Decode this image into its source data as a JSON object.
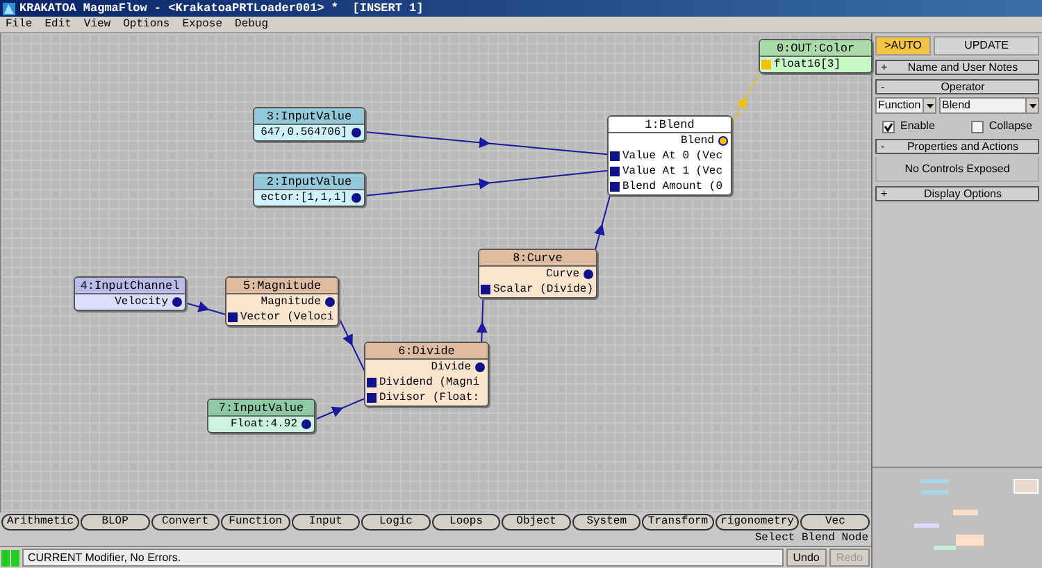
{
  "window": {
    "title": "KRAKATOA MagmaFlow - <KrakatoaPRTLoader001> *  [INSERT 1]"
  },
  "menu": [
    "File",
    "Edit",
    "View",
    "Options",
    "Expose",
    "Debug"
  ],
  "nodes": [
    {
      "title": "0:OUT:Color",
      "kind": "output",
      "rows": [
        {
          "label": "float16[3]",
          "kind": "input",
          "highlighted": true
        }
      ]
    },
    {
      "title": "3:InputValue",
      "kind": "vector_input",
      "rows": [
        {
          "label": "647,0.564706]",
          "kind": "output",
          "highlighted": false
        }
      ]
    },
    {
      "title": "1:Blend",
      "kind": "active",
      "rows": [
        {
          "label": "Blend",
          "kind": "output",
          "highlighted": true
        },
        {
          "label": "Value At 0 (Vec",
          "kind": "input",
          "highlighted": false
        },
        {
          "label": "Value At 1 (Vec",
          "kind": "input",
          "highlighted": false
        },
        {
          "label": "Blend Amount (0",
          "kind": "input",
          "highlighted": false
        }
      ]
    },
    {
      "title": "2:InputValue",
      "kind": "vector_input",
      "rows": [
        {
          "label": "ector:[1,1,1]",
          "kind": "output",
          "highlighted": false
        }
      ]
    },
    {
      "title": "8:Curve",
      "kind": "operator",
      "rows": [
        {
          "label": "Curve",
          "kind": "output",
          "highlighted": false
        },
        {
          "label": "Scalar (Divide)",
          "kind": "input",
          "highlighted": false
        }
      ]
    },
    {
      "title": "4:InputChannel",
      "kind": "channel",
      "rows": [
        {
          "label": "Velocity",
          "kind": "output",
          "highlighted": false
        }
      ]
    },
    {
      "title": "5:Magnitude",
      "kind": "operator",
      "rows": [
        {
          "label": "Magnitude",
          "kind": "output",
          "highlighted": false
        },
        {
          "label": "Vector (Veloci",
          "kind": "input",
          "highlighted": false
        }
      ]
    },
    {
      "title": "6:Divide",
      "kind": "operator",
      "rows": [
        {
          "label": "Divide",
          "kind": "output",
          "highlighted": false
        },
        {
          "label": "Dividend (Magni",
          "kind": "input",
          "highlighted": false
        },
        {
          "label": "Divisor (Float:",
          "kind": "input",
          "highlighted": false
        }
      ]
    },
    {
      "title": "7:InputValue",
      "kind": "float_input",
      "rows": [
        {
          "label": "Float:4.92",
          "kind": "output",
          "highlighted": false
        }
      ]
    }
  ],
  "panel": {
    "buttons": [
      {
        "label": ">AUTO",
        "selected": true
      },
      {
        "label": "UPDATE",
        "selected": false
      }
    ],
    "rollouts": [
      {
        "title": "Name and User Notes",
        "sign": "+"
      },
      {
        "title": "Operator",
        "sign": "-",
        "dropdowns": [
          "Function",
          "Blend"
        ],
        "checkboxes": [
          {
            "label": "Enable",
            "checked": true
          },
          {
            "label": "Collapse",
            "checked": false
          }
        ]
      },
      {
        "title": "Properties and Actions",
        "sign": "-",
        "message": "No Controls Exposed"
      },
      {
        "title": "Display Options",
        "sign": "+"
      }
    ]
  },
  "categories": [
    "Arithmetic",
    "BLOP",
    "Convert",
    "Function",
    "Input",
    "Logic",
    "Loops",
    "Object",
    "System",
    "Transform",
    "rigonometry",
    "Vec"
  ],
  "hint": "Select Blend Node",
  "status": {
    "message": "CURRENT Modifier, No Errors.",
    "buttons": [
      {
        "label": "Undo",
        "disabled": false
      },
      {
        "label": "Redo",
        "disabled": true
      }
    ]
  }
}
